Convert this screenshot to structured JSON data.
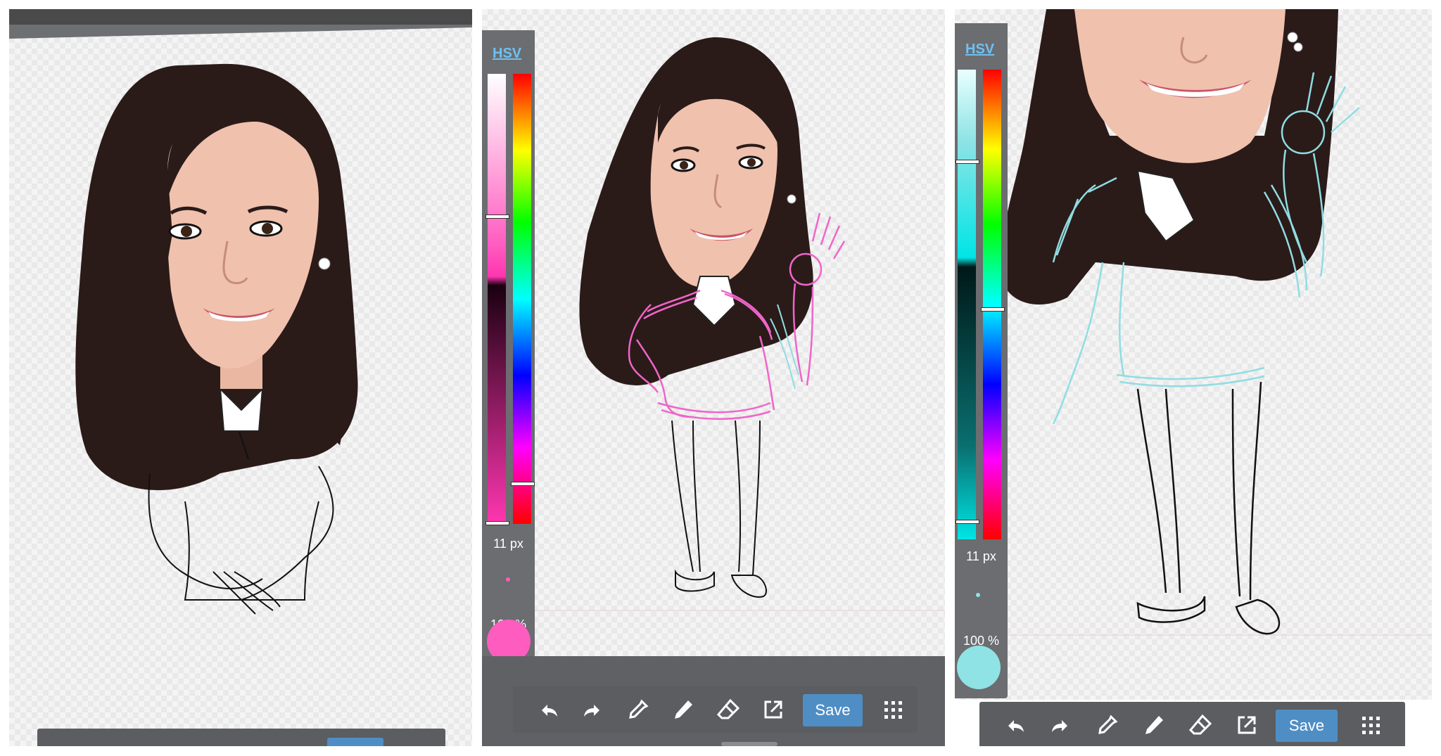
{
  "panels": [
    {
      "id": "panel-1",
      "state": "finished portrait with sketched arms"
    },
    {
      "id": "panel-2",
      "state": "pink sketch layer"
    },
    {
      "id": "panel-3",
      "state": "cyan sketch layer, zoomed"
    }
  ],
  "color_picker": {
    "mode_label": "HSV",
    "brush_size": "11 px",
    "opacity": "100 %"
  },
  "panel2": {
    "active_color": "#ff5cc0",
    "mode_label": "HSV",
    "brush_size": "11 px",
    "opacity": "100 %"
  },
  "panel3": {
    "active_color": "#8fe3e5",
    "mode_label": "HSV",
    "brush_size": "11 px",
    "opacity": "100 %"
  },
  "toolbar": {
    "tools": [
      "undo-icon",
      "redo-icon",
      "eyedropper-icon",
      "pen-icon",
      "eraser-icon",
      "export-icon"
    ],
    "save_label": "Save",
    "menu_icon": "grid-menu-icon"
  },
  "colors": {
    "ui_gray": "#6b6d70",
    "save_blue": "#4f8ec5",
    "hair": "#2a1b19",
    "skin": "#f0c1ad",
    "pink_sketch": "#f065c8",
    "cyan_sketch": "#8fdde2"
  }
}
